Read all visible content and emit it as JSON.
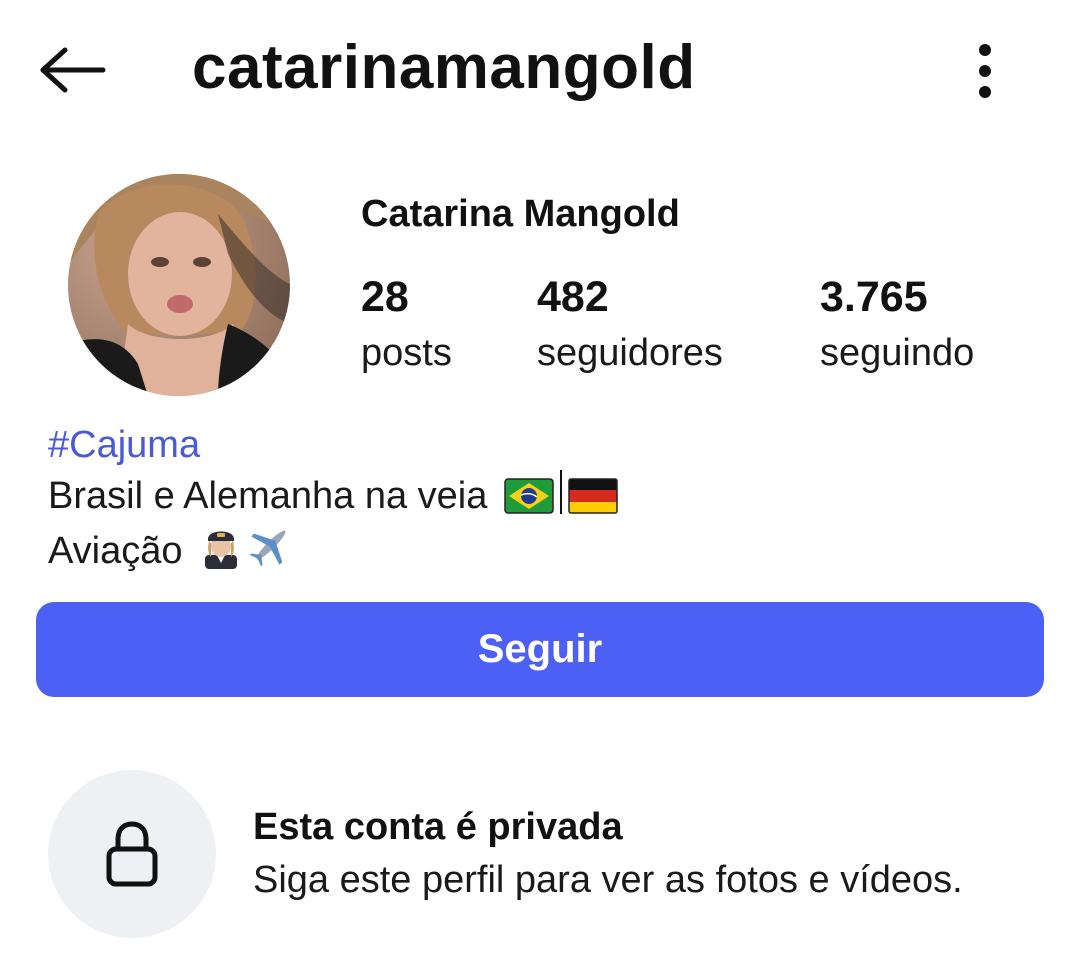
{
  "header": {
    "username": "catarinamangold",
    "back_icon": "arrow-left-icon",
    "more_icon": "more-vertical-icon"
  },
  "profile": {
    "display_name": "Catarina Mangold",
    "stats": [
      {
        "count": "28",
        "label": "posts"
      },
      {
        "count": "482",
        "label": "seguidores"
      },
      {
        "count": "3.765",
        "label": "seguindo"
      }
    ]
  },
  "bio": {
    "hashtag": "#Cajuma",
    "line1": "Brasil e Alemanha na veia",
    "line2": "Aviação",
    "line1_icons": [
      "brazil-flag-icon",
      "separator-bar",
      "germany-flag-icon"
    ],
    "line2_icons": [
      "pilot-emoji-icon",
      "airplane-emoji-icon"
    ]
  },
  "actions": {
    "follow_label": "Seguir"
  },
  "private_notice": {
    "title": "Esta conta é privada",
    "subtitle": "Siga este perfil para ver as fotos e vídeos.",
    "icon": "lock-icon"
  },
  "colors": {
    "accent": "#4c60f6",
    "hashtag": "#4a5ad6",
    "lock_bg": "#eff0f4",
    "text": "#111111"
  }
}
